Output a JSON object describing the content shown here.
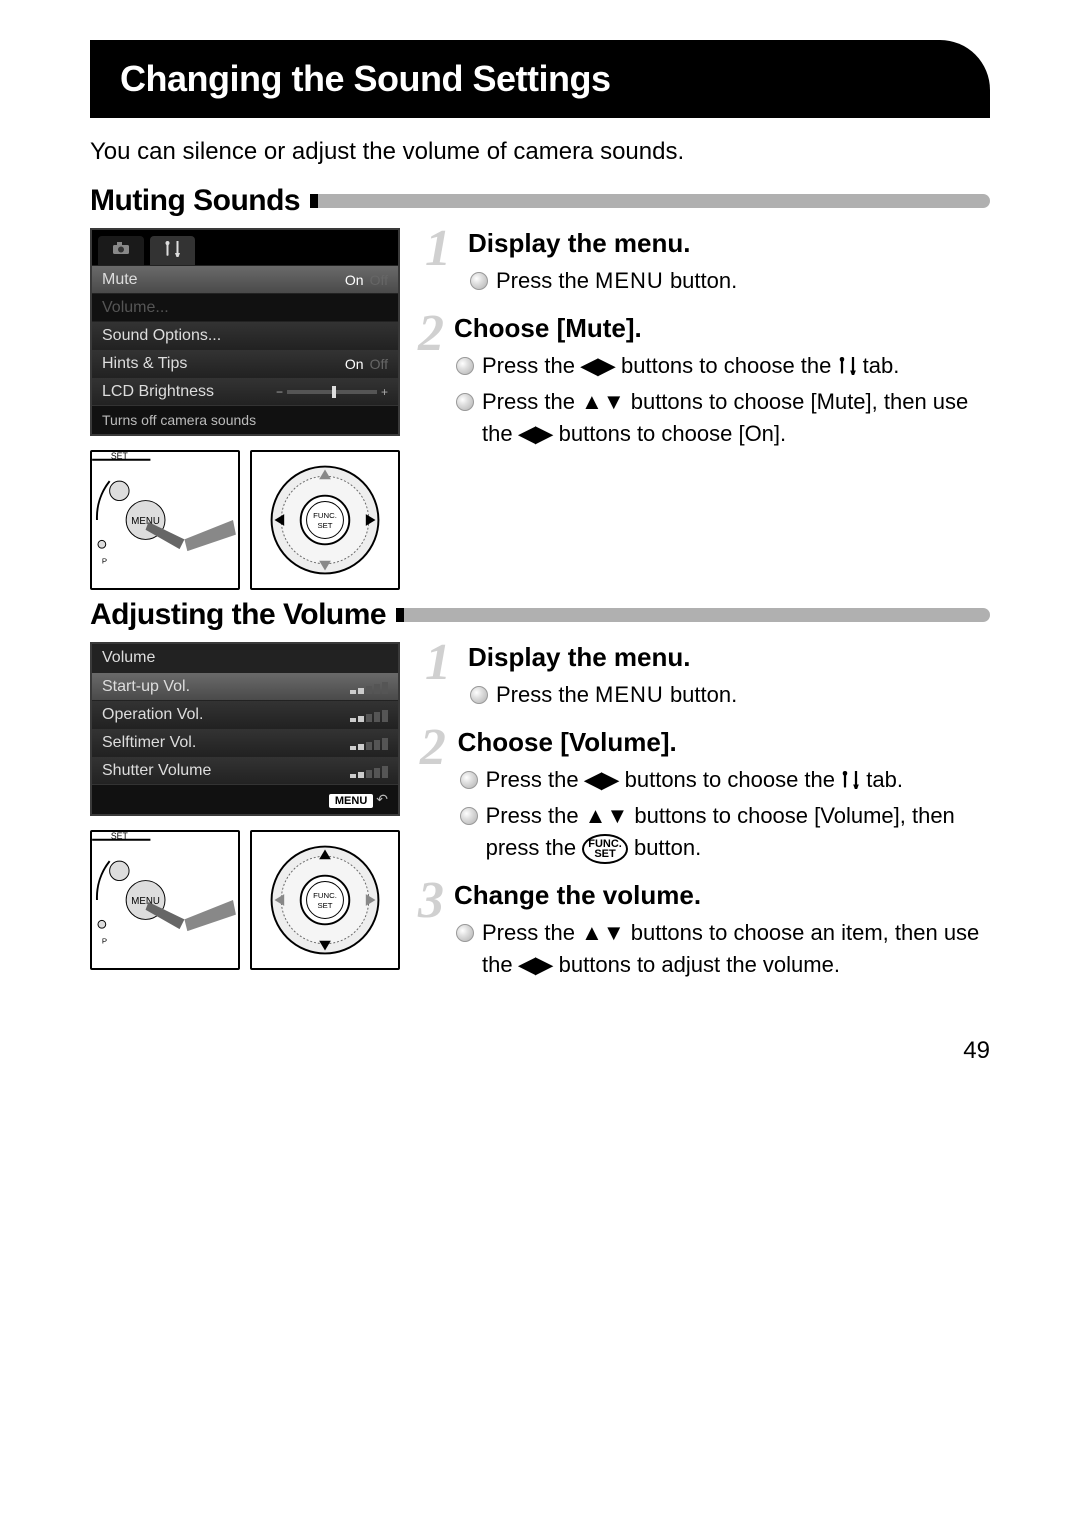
{
  "page_number": "49",
  "title": "Changing the Sound Settings",
  "intro": "You can silence or adjust the volume of camera sounds.",
  "section1": {
    "heading": "Muting Sounds",
    "lcd": {
      "rows": {
        "mute": "Mute",
        "mute_on": "On",
        "mute_off": "Off",
        "volume": "Volume...",
        "sound_options": "Sound Options...",
        "hints": "Hints & Tips",
        "hints_on": "On",
        "hints_off": "Off",
        "brightness": "LCD Brightness"
      },
      "footer": "Turns off camera sounds"
    },
    "steps": [
      {
        "num": "1",
        "title": "Display the menu.",
        "items": [
          {
            "pre": "Press the ",
            "tag": "MENU",
            "post": " button."
          }
        ]
      },
      {
        "num": "2",
        "title": "Choose [Mute].",
        "items": [
          {
            "pre": "Press the ",
            "tag": "LR",
            "post": " buttons to choose the ",
            "tag2": "TOOLS",
            "post2": " tab."
          },
          {
            "pre": "Press the ",
            "tag": "UD",
            "post": " buttons to choose [Mute], then use the ",
            "tag2": "LR",
            "post2": " buttons to choose [On]."
          }
        ]
      }
    ]
  },
  "section2": {
    "heading": "Adjusting the Volume",
    "lcd": {
      "title": "Volume",
      "rows": {
        "startup": "Start-up Vol.",
        "operation": "Operation Vol.",
        "selftimer": "Selftimer Vol.",
        "shutter": "Shutter Volume"
      },
      "menu_label": "MENU"
    },
    "steps": [
      {
        "num": "1",
        "title": "Display the menu.",
        "items": [
          {
            "pre": "Press the ",
            "tag": "MENU",
            "post": " button."
          }
        ]
      },
      {
        "num": "2",
        "title": "Choose [Volume].",
        "items": [
          {
            "pre": "Press the ",
            "tag": "LR",
            "post": " buttons to choose the ",
            "tag2": "TOOLS",
            "post2": " tab."
          },
          {
            "pre": "Press the ",
            "tag": "UD",
            "post": " buttons to choose [Volume], then press the ",
            "tag2": "FUNC",
            "post2": " button."
          }
        ]
      },
      {
        "num": "3",
        "title": "Change the volume.",
        "items": [
          {
            "pre": "Press the ",
            "tag": "UD",
            "post": " buttons to choose an item, then use the ",
            "tag2": "LR",
            "post2": " buttons to adjust the volume."
          }
        ]
      }
    ]
  },
  "glyphs": {
    "LR": "◀▶",
    "UD": "▲▼",
    "TOOLS": "⚒",
    "MENU": "MENU",
    "FUNC_TOP": "FUNC.",
    "FUNC_BOT": "SET",
    "BACK": "↶"
  }
}
